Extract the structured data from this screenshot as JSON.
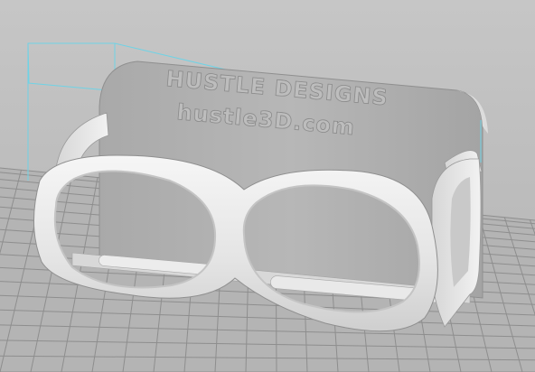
{
  "viewport": {
    "background_color": "#bdbdbd",
    "grid_color": "#8e8e8e",
    "build_plate_color": "#b0b0b0",
    "bounding_box_color": "#6fd3e6",
    "model_color": "#e6e6e6"
  },
  "model": {
    "embossed_text_line1": "HUSTLE DESIGNS",
    "embossed_text_line2": "hustle3D.com"
  }
}
